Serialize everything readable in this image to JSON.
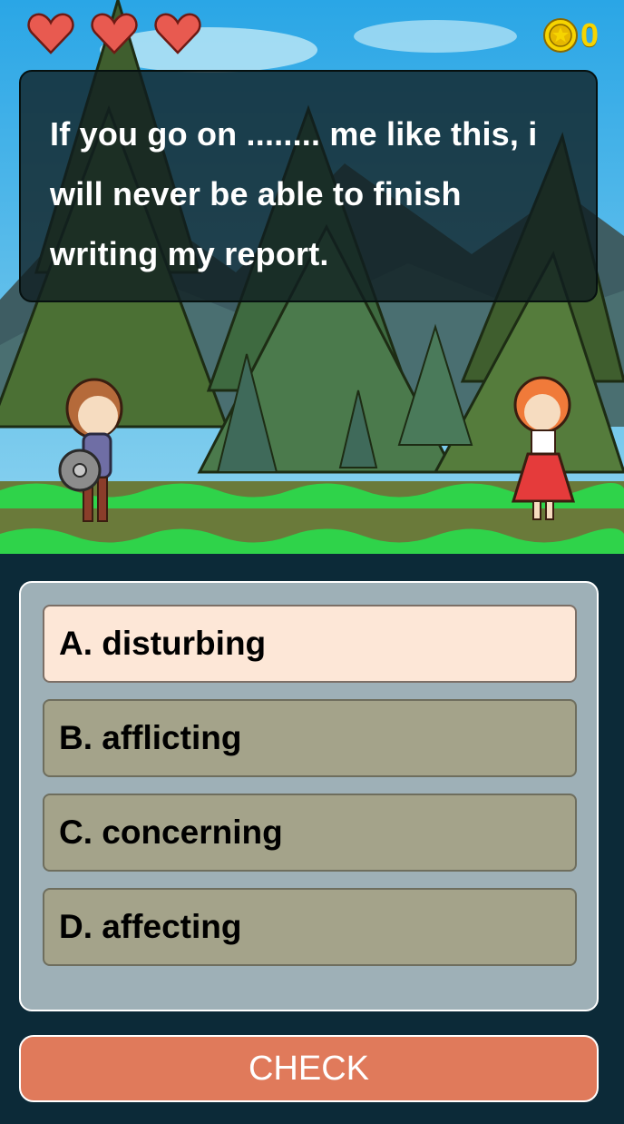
{
  "hud": {
    "hearts": [
      "heart",
      "heart",
      "heart"
    ],
    "coin_count": "0"
  },
  "question": {
    "text": "If you go on ........ me like this, i will never be able to finish writing my report."
  },
  "options": [
    {
      "label": "A. disturbing",
      "selected": true
    },
    {
      "label": "B. afflicting",
      "selected": false
    },
    {
      "label": "C. concerning",
      "selected": false
    },
    {
      "label": "D. affecting",
      "selected": false
    }
  ],
  "check_button": {
    "label": "CHECK"
  },
  "colors": {
    "heart": "#e85a50",
    "coin": "#f6d400",
    "option_bg": "#a4a38a",
    "option_selected_bg": "#fde7d7",
    "check_bg": "#e07a5b",
    "panel_bg": "#9eb0b7"
  }
}
